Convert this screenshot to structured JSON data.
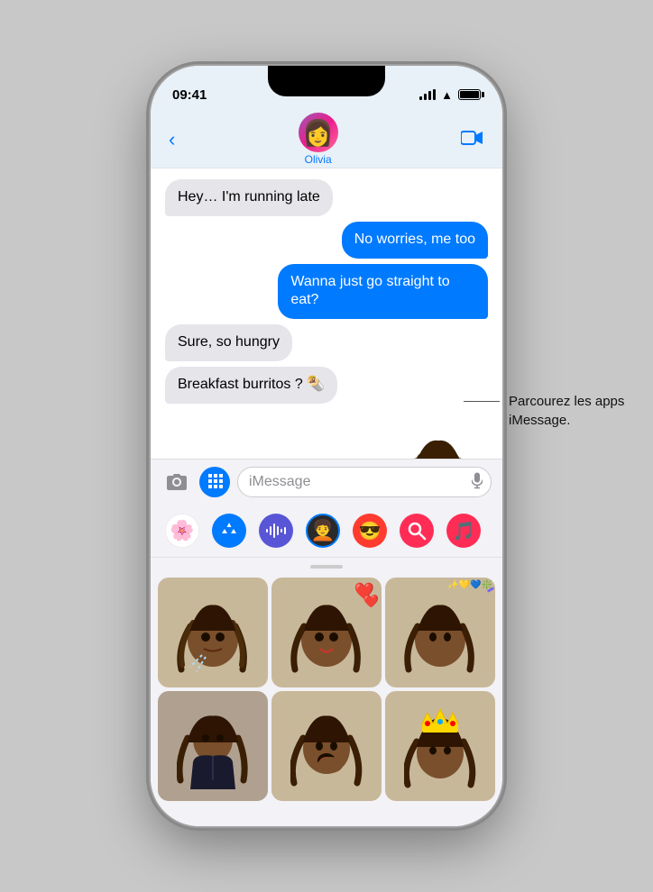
{
  "status_bar": {
    "time": "09:41",
    "signal_label": "signal",
    "wifi_label": "wifi",
    "battery_label": "battery"
  },
  "nav": {
    "back_label": "‹",
    "contact_name": "Olivia",
    "video_label": "⬜"
  },
  "messages": [
    {
      "id": "m1",
      "type": "received",
      "text": "Hey… I'm running late"
    },
    {
      "id": "m2",
      "type": "sent",
      "text": "No worries, me too"
    },
    {
      "id": "m3",
      "type": "sent",
      "text": "Wanna just go straight to eat?"
    },
    {
      "id": "m4",
      "type": "received",
      "text": "Sure, so hungry"
    },
    {
      "id": "m5",
      "type": "received",
      "text": "Breakfast burritos ? 🌯"
    }
  ],
  "input": {
    "placeholder": "iMessage",
    "camera_label": "camera",
    "apps_label": "apps",
    "mic_label": "mic"
  },
  "apps_strip": {
    "icons": [
      {
        "name": "photos-icon",
        "emoji": "🌸",
        "bg": "#fff",
        "label": "Photos"
      },
      {
        "name": "appstore-icon",
        "emoji": "🅐",
        "bg": "#007aff",
        "label": "App Store"
      },
      {
        "name": "audio-icon",
        "emoji": "🎵",
        "bg": "#5856d6",
        "label": "Audio"
      },
      {
        "name": "memoji-icon",
        "emoji": "😎",
        "bg": "#ffcc00",
        "label": "Memoji"
      },
      {
        "name": "stickers-icon",
        "emoji": "🤩",
        "bg": "#ff3b30",
        "label": "Stickers"
      },
      {
        "name": "search-icon",
        "emoji": "🔍",
        "bg": "#ff2d55",
        "label": "Search"
      },
      {
        "name": "music-icon",
        "emoji": "🎵",
        "bg": "#ff2d55",
        "label": "Music"
      }
    ]
  },
  "annotation": {
    "text": "Parcourez les apps iMessage."
  },
  "stickers": [
    {
      "id": "s1",
      "label": "memoji-sneeze"
    },
    {
      "id": "s2",
      "label": "memoji-love"
    },
    {
      "id": "s3",
      "label": "memoji-confetti"
    },
    {
      "id": "s4",
      "label": "memoji-coat"
    },
    {
      "id": "s5",
      "label": "memoji-yawn"
    },
    {
      "id": "s6",
      "label": "memoji-crown"
    }
  ]
}
